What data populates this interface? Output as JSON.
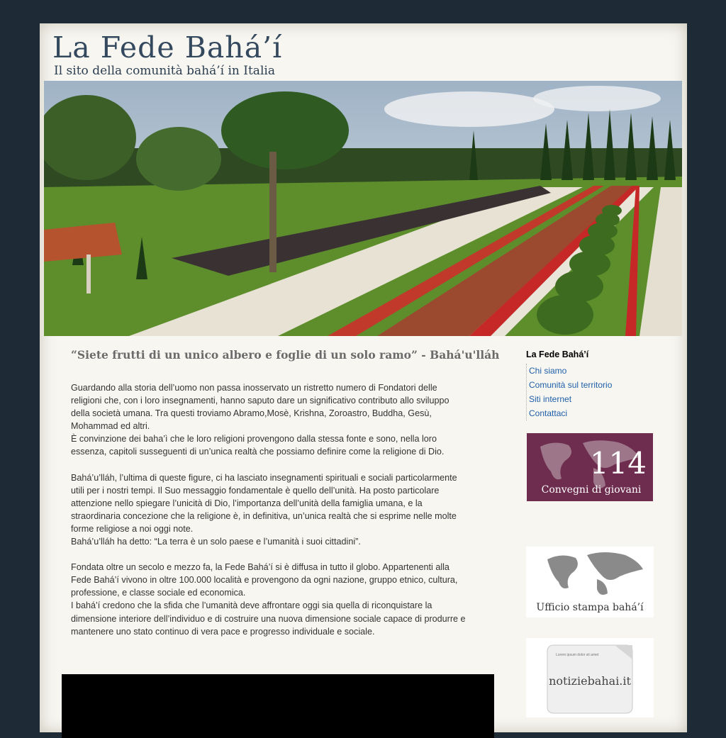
{
  "header": {
    "title": "La Fede Bahá’í",
    "subtitle": "Il sito della comunità bahá’í in Italia"
  },
  "main": {
    "quote": "“Siete frutti di un unico albero e foglie di un solo ramo” - Bahá'u'lláh",
    "paragraphs": [
      [
        "Guardando alla storia dell’uomo non passa inosservato un ristretto numero di Fondatori delle",
        "religioni  che,  con i loro insegnamenti, hanno saputo dare un significativo contributo allo sviluppo",
        "della società umana. Tra questi troviamo Abramo,Mosè, Krishna, Zoroastro, Buddha, Gesù,",
        "Mohammad ed altri.",
        "È convinzione dei baha’ì che le loro religioni provengono dalla stessa fonte e sono, nella loro",
        "essenza, capitoli susseguenti di un’unica realtà che possiamo definire come la religione di Dio."
      ],
      [
        "Bahá’u’lláh, l’ultima di queste figure, ci ha lasciato insegnamenti spirituali e sociali particolarmente",
        "utili per i nostri tempi. Il Suo messaggio fondamentale è quello dell’unità. Ha posto particolare",
        "attenzione nello spiegare  l’unicità di Dio, l’importanza dell’unità della famiglia umana, e la",
        "straordinaria concezione che la religione è, in definitiva, un’unica realtà che si esprime nelle molte",
        "forme religiose a noi oggi note.",
        "Bahá’u’lláh ha detto: “La terra è un solo paese e l’umanità i suoi cittadini”."
      ],
      [
        "Fondata oltre un secolo e mezzo fa, la Fede Bahá’í si è diffusa in tutto il globo. Appartenenti alla",
        "Fede Bahá’í vivono in oltre 100.000 località e provengono da ogni nazione, gruppo etnico, cultura,",
        "professione, e classe sociale ed economica.",
        "I bahá’í credono che la sfida che l’umanità deve affrontare oggi sia quella di riconquistare la",
        "dimensione interiore dell’individuo e di costruire una nuova dimensione sociale capace di produrre e",
        "mantenere uno stato continuo di vera pace e progresso individuale e sociale."
      ]
    ]
  },
  "sidebar": {
    "title": "La Fede Bahá’í",
    "links": [
      "Chi siamo",
      "Comunità sul territorio",
      "Siti internet",
      "Contattaci"
    ],
    "youth_badge": {
      "number": "114",
      "caption": "Convegni di giovani"
    },
    "press_badge": {
      "caption": "Ufficio stampa bahá’í"
    },
    "news_badge": {
      "small_text": "Lorem ipsum dolor sit amet",
      "caption": "notiziebahai.it"
    }
  },
  "colors": {
    "background": "#1e2a35",
    "page": "#f7f6f1",
    "title": "#34495e",
    "link": "#1f5fa8",
    "youth_badge": "#6e2d4e"
  }
}
